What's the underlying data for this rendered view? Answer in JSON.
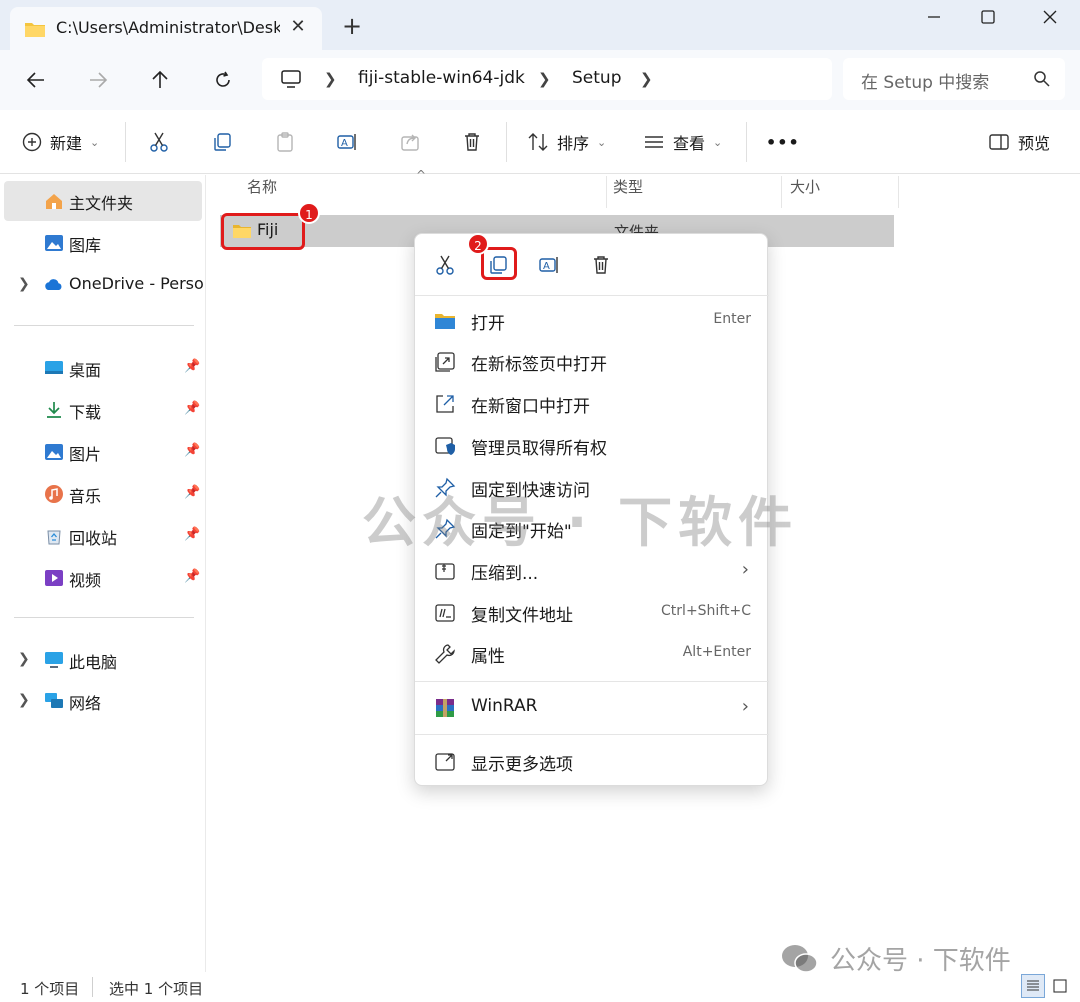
{
  "tab": {
    "title": "C:\\Users\\Administrator\\Desktop",
    "close": "✕",
    "new": "+"
  },
  "window": {
    "minimize": "—",
    "maximize": "☐",
    "close": "✕"
  },
  "address": {
    "crumbs": [
      "fiji-stable-win64-jdk",
      "Setup"
    ],
    "search_placeholder": "在 Setup 中搜索"
  },
  "commandbar": {
    "new_label": "新建",
    "sort_label": "排序",
    "view_label": "查看",
    "more_label": "•••",
    "preview_label": "预览"
  },
  "sidebar": {
    "home": "主文件夹",
    "gallery": "图库",
    "onedrive": "OneDrive - Personal",
    "quick": [
      "桌面",
      "下载",
      "图片",
      "音乐",
      "回收站",
      "视频"
    ],
    "thispc": "此电脑",
    "network": "网络"
  },
  "columns": {
    "name": "名称",
    "type": "类型",
    "size": "大小"
  },
  "file": {
    "name": "Fiji",
    "type": "文件夹"
  },
  "badges": {
    "one": "1",
    "two": "2"
  },
  "context_menu": {
    "items": [
      {
        "label": "打开",
        "shortcut": "Enter"
      },
      {
        "label": "在新标签页中打开",
        "shortcut": ""
      },
      {
        "label": "在新窗口中打开",
        "shortcut": ""
      },
      {
        "label": "管理员取得所有权",
        "shortcut": ""
      },
      {
        "label": "固定到快速访问",
        "shortcut": ""
      },
      {
        "label": "固定到\"开始\"",
        "shortcut": ""
      },
      {
        "label": "压缩到...",
        "shortcut": ""
      },
      {
        "label": "复制文件地址",
        "shortcut": "Ctrl+Shift+C"
      },
      {
        "label": "属性",
        "shortcut": "Alt+Enter"
      }
    ],
    "winrar": "WinRAR",
    "more_options": "显示更多选项"
  },
  "watermark": {
    "center": "公众号 · 下软件",
    "corner": "公众号 · 下软件"
  },
  "status": {
    "count": "1 个项目",
    "selected": "选中 1 个项目"
  }
}
